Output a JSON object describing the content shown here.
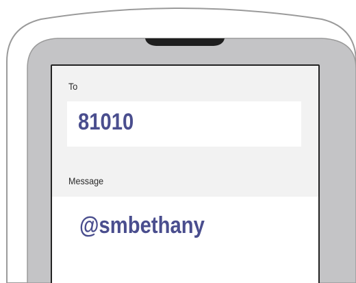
{
  "compose": {
    "to_label": "To",
    "to_value": "81010",
    "message_label": "Message",
    "message_value": "@smbethany"
  },
  "colors": {
    "shell_outline": "#9a9a9a",
    "shell_inner": "#c4c4c6",
    "screen_background": "#f2f2f2",
    "field_background": "#ffffff",
    "entered_text": "#4a4e8e"
  }
}
